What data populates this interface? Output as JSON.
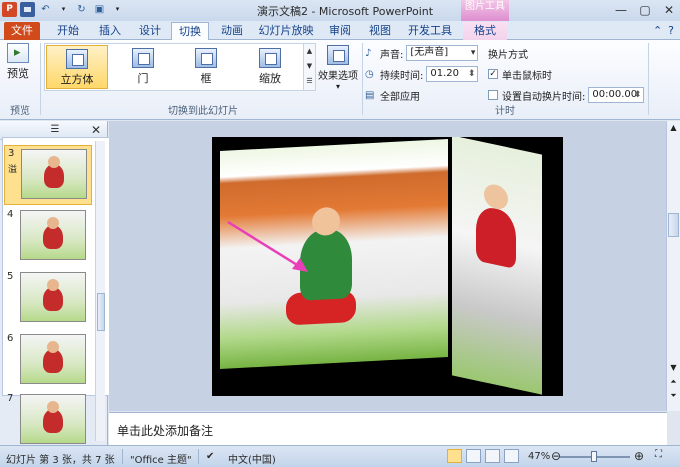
{
  "titlebar": {
    "title": "演示文稿2 - Microsoft PowerPoint",
    "picture_tools": "图片工具",
    "app_icon": "P",
    "window_controls": [
      "—",
      "▢",
      "✕"
    ]
  },
  "tabs": [
    {
      "label": "文件"
    },
    {
      "label": "开始"
    },
    {
      "label": "插入"
    },
    {
      "label": "设计"
    },
    {
      "label": "切换"
    },
    {
      "label": "动画"
    },
    {
      "label": "幻灯片放映"
    },
    {
      "label": "审阅"
    },
    {
      "label": "视图"
    },
    {
      "label": "开发工具"
    },
    {
      "label": "格式"
    }
  ],
  "ribbon": {
    "preview": {
      "label": "预览",
      "group": "预览"
    },
    "transitions": {
      "group": "切换到此幻灯片",
      "items": [
        "立方体",
        "门",
        "框",
        "缩放"
      ],
      "selected": "立方体",
      "effect_options": "效果选项"
    },
    "timing": {
      "group": "计时",
      "sound_label": "声音:",
      "sound_value": "[无声音]",
      "duration_label": "持续时间:",
      "duration_value": "01.20",
      "apply_all": "全部应用",
      "advance_title": "换片方式",
      "on_click": "单击鼠标时",
      "on_click_checked": true,
      "after_label": "设置自动换片时间:",
      "after_checked": false,
      "after_value": "00:00.00"
    }
  },
  "slides_pane": {
    "thumbnails": [
      {
        "num": "3",
        "star": "溢",
        "selected": true
      },
      {
        "num": "4",
        "star": "",
        "selected": false
      },
      {
        "num": "5",
        "star": "",
        "selected": false
      },
      {
        "num": "6",
        "star": "",
        "selected": false
      },
      {
        "num": "7",
        "star": "",
        "selected": false
      }
    ]
  },
  "notes": {
    "placeholder": "单击此处添加备注"
  },
  "statusbar": {
    "slide_info": "幻灯片 第 3 张，共 7 张",
    "theme": "\"Office 主题\"",
    "language": "中文(中国)",
    "zoom": "47%",
    "zoom_level": 0.47
  },
  "colors": {
    "file_tab": "#d04a1c",
    "picture_tools": "#dd8ed0",
    "selection": "#ffd86a",
    "arrow": "#e83fb8"
  }
}
